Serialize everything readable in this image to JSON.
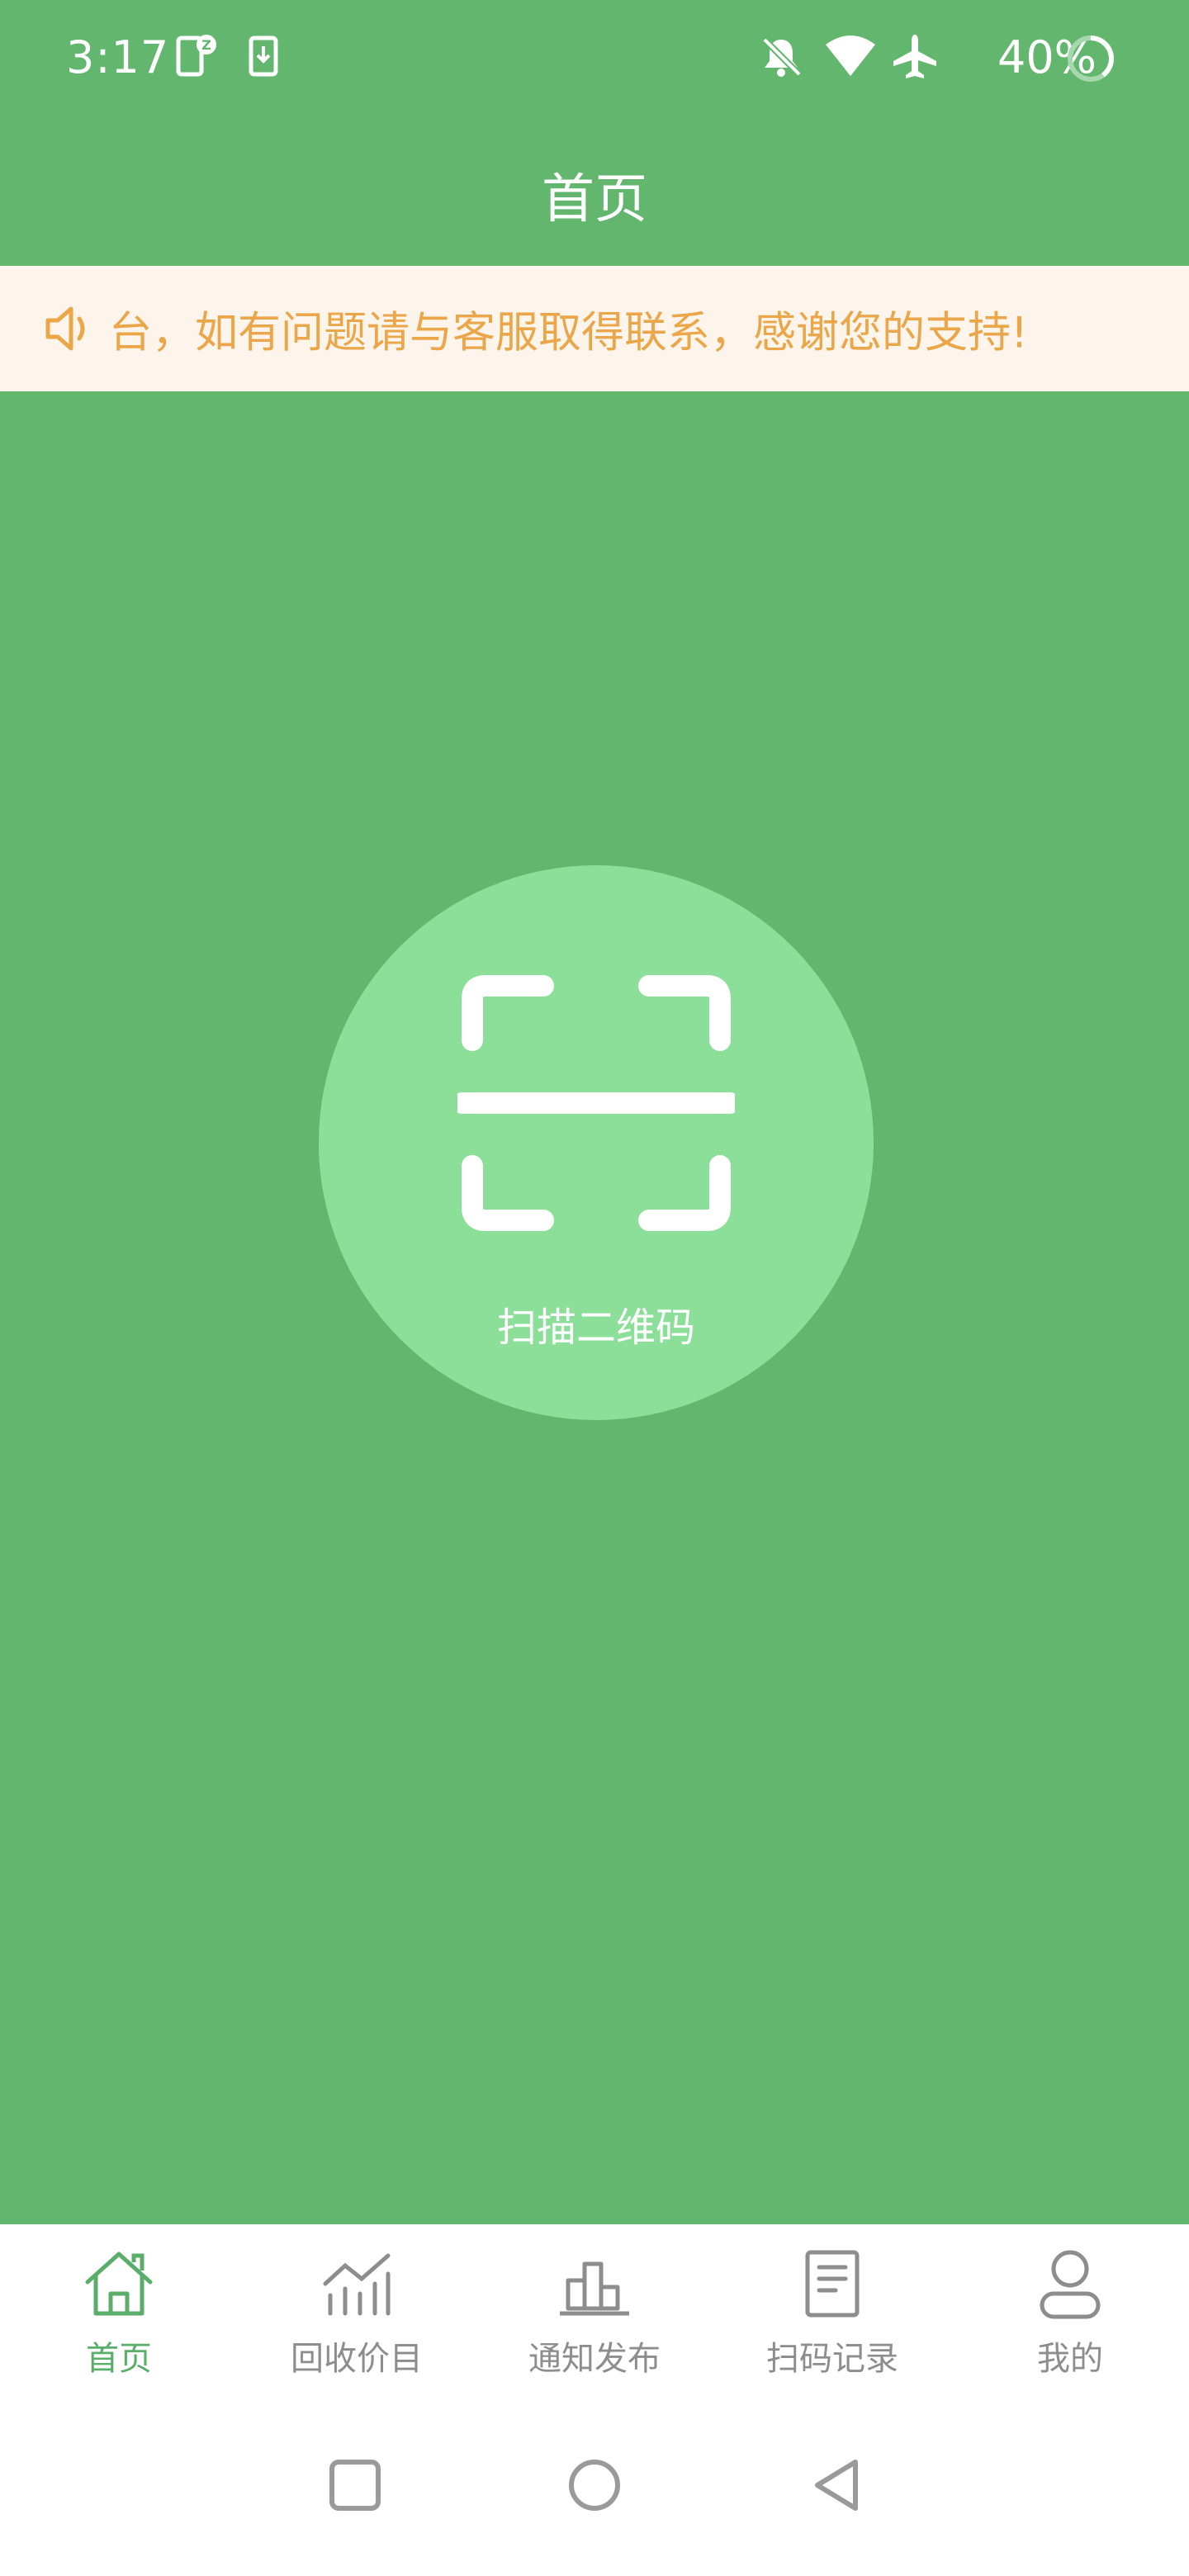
{
  "status_bar": {
    "time": "3:17",
    "battery": "40%",
    "icons": [
      "notification-z-icon",
      "download-icon",
      "bell-muted-icon",
      "wifi-icon",
      "airplane-icon",
      "battery-ring-icon"
    ]
  },
  "header": {
    "title": "首页"
  },
  "notice": {
    "icon": "speaker-icon",
    "text": "台，如有问题请与客服取得联系，感谢您的支持!"
  },
  "scan": {
    "label": "扫描二维码",
    "icon": "scan-qr-icon"
  },
  "tabs": [
    {
      "label": "首页",
      "icon": "home-icon",
      "active": true
    },
    {
      "label": "回收价目",
      "icon": "chart-icon",
      "active": false
    },
    {
      "label": "通知发布",
      "icon": "bar-icon",
      "active": false
    },
    {
      "label": "扫码记录",
      "icon": "document-icon",
      "active": false
    },
    {
      "label": "我的",
      "icon": "user-icon",
      "active": false
    }
  ],
  "colors": {
    "primary": "#63b66d",
    "circle": "#8bdf98",
    "notice_text": "#eaa648",
    "notice_bg": "#fdf5ec",
    "tab_active": "#5aae6a",
    "tab_inactive": "#8d8d8d"
  }
}
